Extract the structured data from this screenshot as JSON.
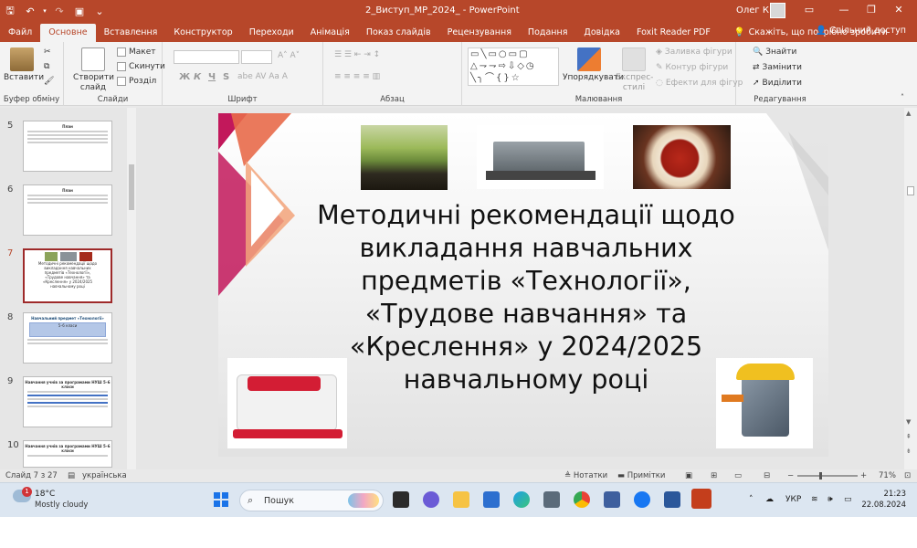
{
  "titlebar": {
    "doc_title": "2_Виступ_МР_2024_  -  PowerPoint",
    "user": "Олег К",
    "save_icon": "🖫",
    "undo_icon": "↶",
    "redo_icon": "↷",
    "present_icon": "▣",
    "customize_icon": "⌄",
    "ribbon_opts_icon": "▭",
    "minimize_icon": "—",
    "restore_icon": "❐",
    "close_icon": "✕"
  },
  "tabs": [
    "Файл",
    "Основне",
    "Вставлення",
    "Конструктор",
    "Переходи",
    "Анімація",
    "Показ слайдів",
    "Рецензування",
    "Подання",
    "Довідка",
    "Foxit Reader PDF"
  ],
  "active_tab": "Основне",
  "tell_me": "Скажіть, що потрібно зробити",
  "share": "Спільний доступ",
  "ribbon": {
    "paste": "Вставити",
    "clipboard": "Буфер обміну",
    "new_slide_1": "Створити",
    "new_slide_2": "слайд",
    "layout": "Макет",
    "reset": "Скинути",
    "section": "Розділ",
    "slides": "Слайди",
    "font": "Шрифт",
    "bold": "Ж",
    "italic": "К",
    "underline": "Ч",
    "strike": "S",
    "paragraph": "Абзац",
    "arrange_1": "Упорядкувати",
    "quick_styles_1": "Експрес-",
    "quick_styles_2": "стилі",
    "shape_fill": "Заливка фігури",
    "shape_outline": "Контур фігури",
    "shape_effects": "Ефекти для фігур",
    "drawing": "Малювання",
    "find": "Знайти",
    "replace": "Замінити",
    "select": "Виділити",
    "editing": "Редагування",
    "shapes_preview": "▭╲▭○▭▢ △⇁⇁⇨⇩◇◷ ╲╮⌒{}☆"
  },
  "slides": [
    {
      "num": "5",
      "title": "План"
    },
    {
      "num": "6",
      "title": "План"
    },
    {
      "num": "7",
      "title": "Методичні рекомендації щодо викладання навчальних предметів «Технології», «Трудове навчання» та «Креслення» у 2024/2025 навчальному році"
    },
    {
      "num": "8",
      "title": "Навчальний предмет «Технології»"
    },
    {
      "num": "9",
      "title": "Навчання учнів за програмами НУШ 5–6 класи"
    },
    {
      "num": "10",
      "title": "Навчання учнів за програмами НУШ 5–6 класи"
    }
  ],
  "slide8_table_title": "5–6 класи",
  "main_slide": {
    "title": "Методичні рекомендації щодо викладання навчальних предметів «Технології», «Трудове навчання» та «Креслення» у 2024/2025 навчальному році"
  },
  "status": {
    "slide_pos": "Слайд 7 з 27",
    "language": "українська",
    "notes": "Нотатки",
    "comments": "Примітки",
    "zoom": "71%",
    "zoom_minus": "−",
    "zoom_plus": "+"
  },
  "taskbar": {
    "temp": "18°C",
    "weather": "Mostly cloudy",
    "badge": "1",
    "search": "Пошук",
    "lang": "УКР",
    "time": "21:23",
    "date": "22.08.2024"
  },
  "colors": {
    "accent": "#b7472a",
    "ribbon_bg": "#f3f3f3",
    "slide_pink": "#c2185b",
    "taskbar_bg": "#dce6f1"
  }
}
